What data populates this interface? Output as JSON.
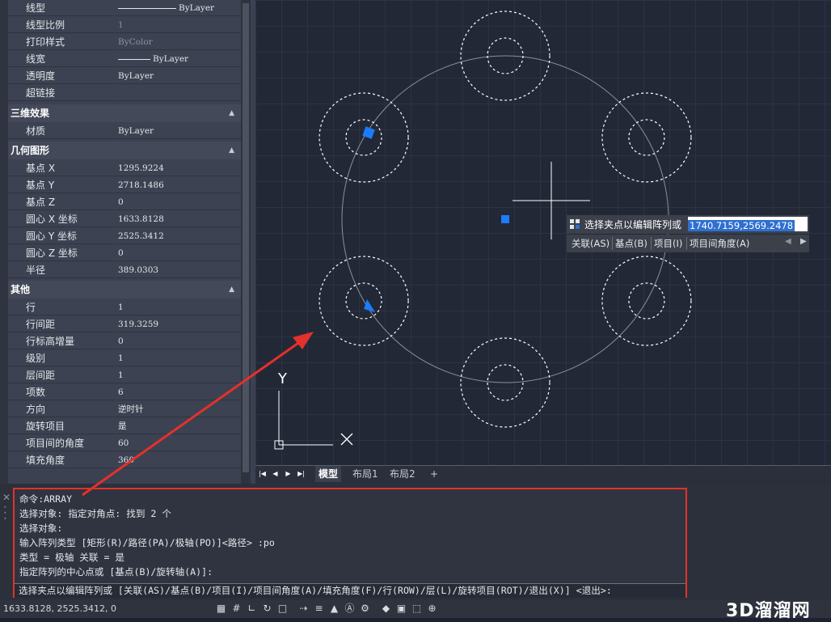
{
  "properties": {
    "general_rows": [
      {
        "label": "线型",
        "value": "ByLayer",
        "line": 72
      },
      {
        "label": "线型比例",
        "value": "1",
        "dim": true
      },
      {
        "label": "打印样式",
        "value": "ByColor",
        "dim": true
      },
      {
        "label": "线宽",
        "value": "ByLayer",
        "line": 40
      },
      {
        "label": "透明度",
        "value": "ByLayer"
      },
      {
        "label": "超链接",
        "value": ""
      }
    ],
    "sections": [
      {
        "title": "三维效果",
        "rows": [
          {
            "label": "材质",
            "value": "ByLayer"
          }
        ]
      },
      {
        "title": "几何图形",
        "rows": [
          {
            "label": "基点 X",
            "value": "1295.9224"
          },
          {
            "label": "基点 Y",
            "value": "2718.1486"
          },
          {
            "label": "基点 Z",
            "value": "0"
          },
          {
            "label": "圆心 X 坐标",
            "value": "1633.8128"
          },
          {
            "label": "圆心 Y 坐标",
            "value": "2525.3412"
          },
          {
            "label": "圆心 Z 坐标",
            "value": "0"
          },
          {
            "label": "半径",
            "value": "389.0303"
          }
        ]
      },
      {
        "title": "其他",
        "rows": [
          {
            "label": "行",
            "value": "1"
          },
          {
            "label": "行间距",
            "value": "319.3259"
          },
          {
            "label": "行标高增量",
            "value": "0"
          },
          {
            "label": "级别",
            "value": "1"
          },
          {
            "label": "层间距",
            "value": "1"
          },
          {
            "label": "项数",
            "value": "6"
          },
          {
            "label": "方向",
            "value": "逆时针"
          },
          {
            "label": "旋转项目",
            "value": "是"
          },
          {
            "label": "项目间的角度",
            "value": "60"
          },
          {
            "label": "填充角度",
            "value": "360"
          }
        ]
      }
    ]
  },
  "viewport": {
    "ucs_y_label": "Y",
    "grip_color": "#1c7cff",
    "tooltip": {
      "prompt": "选择夹点以编辑阵列或",
      "value": "1740.7159,2569.2478",
      "options": [
        "关联(AS)",
        "基点(B)",
        "项目(I)",
        "项目间角度(A)"
      ]
    }
  },
  "layout_tabs": {
    "tabs": [
      "模型",
      "布局1",
      "布局2"
    ],
    "active": "模型",
    "add": "+"
  },
  "command": {
    "lines": [
      "命令:ARRAY",
      "选择对象: 指定对角点: 找到 2 个",
      "选择对象:",
      "输入阵列类型 [矩形(R)/路径(PA)/极轴(PO)]<路径> :po",
      "类型 = 极轴  关联 = 是",
      "指定阵列的中心点或 [基点(B)/旋转轴(A)]:",
      "选择夹点以编辑阵列或 [关联(AS)/基点(B)/项目(I)/项目间角度(A)/填充角度(F)/行(ROW)/层(L)/旋转项目(ROT)/退出(X)] <退出>:"
    ],
    "close": "✕"
  },
  "status": {
    "coords": "1633.8128, 2525.3412, 0",
    "icons": [
      "model-space-icon",
      "grid-icon",
      "ortho-icon",
      "polar-icon",
      "osnap-icon",
      "otrack-icon",
      "lineweight-icon",
      "selection-cycling-icon",
      "annotation-scale-icon",
      "workspace-icon",
      "isolate-icon",
      "hardware-icon",
      "clean-screen-icon",
      "customize-icon"
    ]
  },
  "watermark": "3D溜溜网",
  "annotation_color": "#e4312b"
}
